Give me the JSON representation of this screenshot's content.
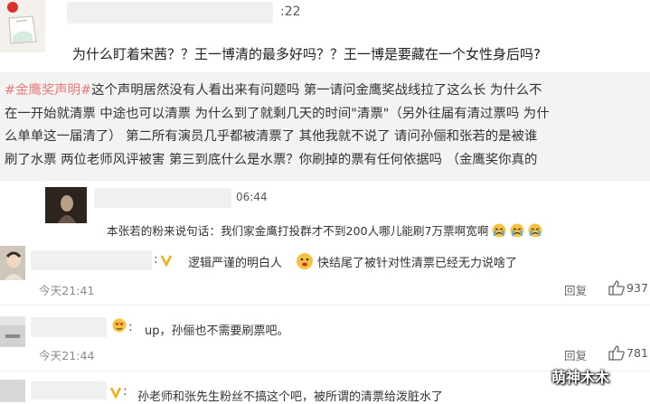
{
  "post1": {
    "time_suffix": ":22",
    "text": "为什么盯着宋茜？？王一博清的最多好吗？？王一博是要藏在一个女性身后吗?"
  },
  "post2": {
    "hashtag": "#金鹰奖声明#",
    "lines": [
      "这个声明居然没有人看出来有问题吗 第一请问金鹰奖战线拉了这么长 为什么不",
      "在一开始就清票 中途也可以清票 为什么到了就剩几天的时间\"清票\"（另外往届有清过票吗 为什",
      "么单单这一届清了） 第二所有演员几乎都被清票了 其他我就不说了 请问孙俪和张若的是被谁",
      "刷了水票 两位老师风评被害 第三到底什么是水票？你刷掉的票有任何依据吗 （金鹰奖你真的"
    ]
  },
  "post3": {
    "time_suffix": "06:44",
    "text": "本张若的粉来说句话：我们家金鹰打投群才不到200人哪儿能刷7万票啊宽啊"
  },
  "comments": [
    {
      "text_a": "逻辑严谨的明白人",
      "text_b": "快结尾了被针对性清票已经无力说啥了",
      "time": "今天21:41",
      "reply": "回复",
      "likes": "937"
    },
    {
      "text": "up，孙俪也不需要刷票吧。",
      "time": "今天21:44",
      "reply": "回复",
      "likes": "781"
    },
    {
      "text": "孙老师和张先生粉丝不搞这个吧，被所谓的清票给泼脏水了"
    }
  ],
  "watermark": "萌神木木",
  "colors": {
    "hashtag": "#e87a78",
    "strip_bg": "#f3f3f3",
    "gold": "#f2b01e"
  }
}
